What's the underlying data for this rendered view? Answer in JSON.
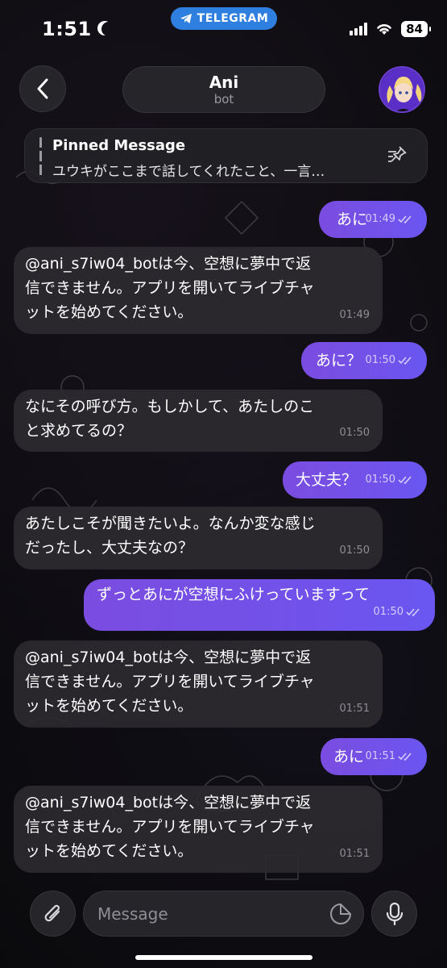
{
  "status_bar": {
    "time": "1:51",
    "app_pill": "TELEGRAM",
    "battery": "84"
  },
  "header": {
    "chat_name": "Ani",
    "chat_subtitle": "bot"
  },
  "pinned": {
    "title": "Pinned Message",
    "text": "ユウキがここまで話してくれたこと、一言…"
  },
  "messages": [
    {
      "dir": "out",
      "text": "あに",
      "time": "01:49"
    },
    {
      "dir": "in",
      "lines": [
        "@ani_s7iw04_botは今、空想に夢中で返",
        "信できません。アプリを開いてライブチャ",
        "ットを始めてください。"
      ],
      "time": "01:49"
    },
    {
      "dir": "out",
      "text": "あに？",
      "time": "01:50"
    },
    {
      "dir": "in",
      "lines": [
        "なにその呼び方。もしかして、あたしのこ",
        "と求めてるの？"
      ],
      "time": "01:50"
    },
    {
      "dir": "out",
      "text": "大丈夫？",
      "time": "01:50"
    },
    {
      "dir": "in",
      "lines": [
        "あたしこそが聞きたいよ。なんか変な感じ",
        "だったし、大丈夫なの？"
      ],
      "time": "01:50"
    },
    {
      "dir": "out",
      "text": "ずっとあにが空想にふけっていますって",
      "time": "01:50"
    },
    {
      "dir": "in",
      "lines": [
        "@ani_s7iw04_botは今、空想に夢中で返",
        "信できません。アプリを開いてライブチャ",
        "ットを始めてください。"
      ],
      "time": "01:51"
    },
    {
      "dir": "out",
      "text": "あに",
      "time": "01:51"
    },
    {
      "dir": "in",
      "lines": [
        "@ani_s7iw04_botは今、空想に夢中で返",
        "信できません。アプリを開いてライブチャ",
        "ットを始めてください。"
      ],
      "time": "01:51"
    }
  ],
  "composer": {
    "placeholder": "Message"
  },
  "icons": {
    "back": "chevron-left-icon",
    "unpin": "unpin-icon",
    "attach": "paperclip-icon",
    "sticker": "sticker-icon",
    "mic": "microphone-icon",
    "read": "double-check-icon"
  },
  "colors": {
    "outgoing": "#7b4ce0",
    "incoming": "#2c2a2e",
    "telegram": "#2f7fe0"
  }
}
